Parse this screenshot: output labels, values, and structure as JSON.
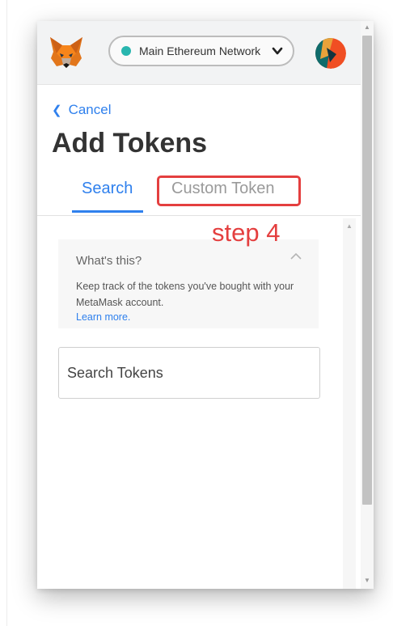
{
  "header": {
    "network_label": "Main Ethereum Network",
    "network_dot_color": "#29b6af",
    "logo_icon": "metamask-fox-icon",
    "avatar_icon": "account-identicon"
  },
  "page": {
    "cancel_label": "Cancel",
    "title": "Add Tokens"
  },
  "tabs": {
    "search_label": "Search",
    "custom_label": "Custom Token",
    "active": "Search"
  },
  "annotation": {
    "step_label": "step 4",
    "color": "#e43f3f"
  },
  "info": {
    "title": "What's this?",
    "body": "Keep track of the tokens you've bought with your MetaMask account.",
    "learn_more": "Learn more."
  },
  "search": {
    "placeholder": "Search Tokens"
  },
  "colors": {
    "accent": "#2f80ed"
  }
}
